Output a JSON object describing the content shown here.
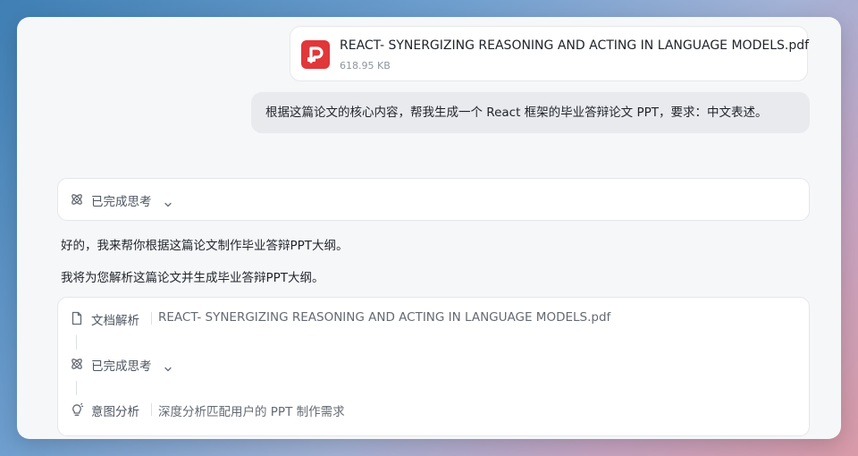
{
  "colors": {
    "accent_pdf": "#e0373a",
    "text_primary": "#1f2329",
    "text_secondary": "#646a73"
  },
  "attachment": {
    "icon": "pdf-file-icon",
    "name": "REACT- SYNERGIZING REASONING AND ACTING IN LANGUAGE MODELS.pdf",
    "size": "618.95 KB"
  },
  "user_message": "根据这篇论文的核心内容，帮我生成一个 React 框架的毕业答辩论文 PPT，要求：中文表述。",
  "thinking": {
    "icon": "atom-icon",
    "label": "已完成思考",
    "toggle_icon": "chevron-down-icon"
  },
  "assistant": {
    "line1": "好的，我来帮你根据这篇论文制作毕业答辩PPT大纲。",
    "line2": "我将为您解析这篇论文并生成毕业答辩PPT大纲。"
  },
  "steps": [
    {
      "icon": "document-icon",
      "label": "文档解析",
      "detail": "REACT- SYNERGIZING REASONING AND ACTING IN LANGUAGE MODELS.pdf"
    },
    {
      "icon": "atom-icon",
      "label": "已完成思考",
      "detail": ""
    },
    {
      "icon": "lightbulb-icon",
      "label": "意图分析",
      "detail": "深度分析匹配用户的 PPT 制作需求"
    }
  ]
}
